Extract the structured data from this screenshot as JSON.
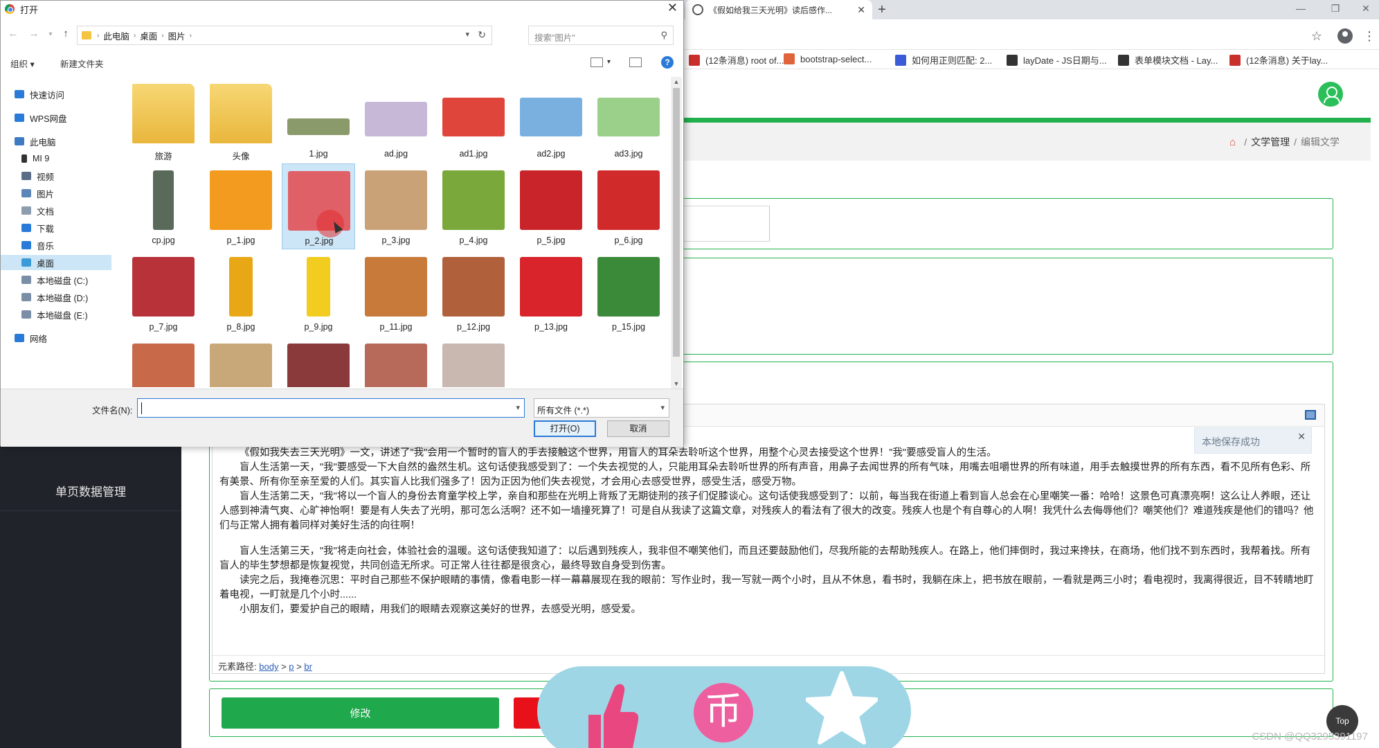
{
  "browser": {
    "tab_title": "《假如给我三天光明》读后感作...",
    "bookmarks": [
      {
        "label": "(12条消息) root of...",
        "color": "#c9302c"
      },
      {
        "label": "bootstrap-select...",
        "color": "#e0643b"
      },
      {
        "label": "如何用正则匹配: 2...",
        "color": "#3b5bd8"
      },
      {
        "label": "layDate - JS日期与...",
        "color": "#333333"
      },
      {
        "label": "表单模块文档 - Lay...",
        "color": "#333333"
      },
      {
        "label": "(12条消息) 关于lay...",
        "color": "#c9302c"
      }
    ]
  },
  "admin": {
    "breadcrumb": {
      "section": "文学管理",
      "current": "编辑文学"
    },
    "sidebar_item": "单页数据管理",
    "editor": {
      "saved_tip": "本地保存成功",
      "paragraphs": [
        "《假如我失去三天光明》一文，讲述了\"我\"会用一个暂时的盲人的手去接触这个世界，用盲人的耳朵去聆听这个世界，用整个心灵去接受这个世界！\"我\"要感受盲人的生活。",
        "盲人生活第一天，\"我\"要感受一下大自然的盎然生机。这句话使我感受到了：一个失去视觉的人，只能用耳朵去聆听世界的所有声音，用鼻子去闻世界的所有气味，用嘴去咀嚼世界的所有味道，用手去触摸世界的所有东西，看不见所有色彩、所有美景、所有你至亲至爱的人们。其实盲人比我们强多了！因为正因为他们失去视觉，才会用心去感受世界，感受生活，感受万物。",
        "盲人生活第二天，\"我\"将以一个盲人的身份去育童学校上学，亲自和那些在光明上背叛了无期徒刑的孩子们促膝谈心。这句话使我感受到了：以前，每当我在街道上看到盲人总会在心里嘲笑一番：哈哈！这景色可真漂亮啊！这么让人养眼，还让人感到神清气爽、心旷神怡啊！要是有人失去了光明，那可怎么活啊？还不如一墙撞死算了！可是自从我读了这篇文章，对残疾人的看法有了很大的改变。残疾人也是个有自尊心的人啊！我凭什么去侮辱他们？嘲笑他们？难道残疾是他们的错吗？他们与正常人拥有着同样对美好生活的向往啊！",
        "盲人生活第三天，\"我\"将走向社会，体验社会的温暖。这句话使我知道了：以后遇到残疾人，我非但不嘲笑他们，而且还要鼓励他们，尽我所能的去帮助残疾人。在路上，他们摔倒时，我过来搀扶，在商场，他们找不到东西时，我帮着找。所有盲人的毕生梦想都是恢复视觉，共同创造无所求。可正常人往往都是很贪心，最终导致自身受到伤害。",
        "读完之后，我掩卷沉思：平时自己那些不保护眼睛的事情，像看电影一样一幕幕展现在我的眼前：写作业时，我一写就一两个小时，且从不休息，看书时，我躺在床上，把书放在眼前，一看就是两三小时；看电视时，我离得很近，目不转睛地盯着电视，一盯就是几个小时......",
        "小朋友们，要爱护自己的眼睛，用我们的眼睛去观察这美好的世界，去感受光明，感受爱。"
      ],
      "path_label": "元素路径:",
      "path": [
        "body",
        "p",
        "br"
      ]
    },
    "modify_button": "修改",
    "top_button": "Top",
    "watermark": "CSDN @QQ3295391197"
  },
  "dialog": {
    "title": "打开",
    "address": [
      "此电脑",
      "桌面",
      "图片"
    ],
    "search_placeholder": "搜索\"图片\"",
    "organize": "组织 ▾",
    "new_folder": "新建文件夹",
    "help": "?",
    "nav": [
      {
        "label": "快速访问",
        "color": "#2a7ad8",
        "indent": 0
      },
      {
        "label": "WPS网盘",
        "color": "#2a7ad8",
        "indent": 0
      },
      {
        "label": "此电脑",
        "color": "#3d7bc4",
        "indent": 0
      },
      {
        "label": "MI 9",
        "color": "#333333",
        "indent": 1
      },
      {
        "label": "视频",
        "color": "#5a6c86",
        "indent": 1
      },
      {
        "label": "图片",
        "color": "#5a86b8",
        "indent": 1
      },
      {
        "label": "文档",
        "color": "#8d9cae",
        "indent": 1
      },
      {
        "label": "下载",
        "color": "#2a7ad8",
        "indent": 1
      },
      {
        "label": "音乐",
        "color": "#2a7ad8",
        "indent": 1
      },
      {
        "label": "桌面",
        "color": "#3d9ad8",
        "indent": 1,
        "selected": true
      },
      {
        "label": "本地磁盘 (C:)",
        "color": "#7a8ea6",
        "indent": 1
      },
      {
        "label": "本地磁盘 (D:)",
        "color": "#7a8ea6",
        "indent": 1
      },
      {
        "label": "本地磁盘 (E:)",
        "color": "#7a8ea6",
        "indent": 1
      },
      {
        "label": "网络",
        "color": "#2a7ad8",
        "indent": 0
      }
    ],
    "files": [
      {
        "name": "旅游",
        "kind": "folder",
        "color": "#e9b63c"
      },
      {
        "name": "头像",
        "kind": "folder",
        "color": "#e9b63c"
      },
      {
        "name": "1.jpg",
        "kind": "image",
        "color": "#8a9a6a"
      },
      {
        "name": "ad.jpg",
        "kind": "image",
        "color": "#c8b8d8"
      },
      {
        "name": "ad1.jpg",
        "kind": "image",
        "color": "#e0453b"
      },
      {
        "name": "ad2.jpg",
        "kind": "image",
        "color": "#7ab0e0"
      },
      {
        "name": "ad3.jpg",
        "kind": "image",
        "color": "#9ad08a"
      },
      {
        "name": "cp.jpg",
        "kind": "image",
        "color": "#5a6a5a"
      },
      {
        "name": "p_1.jpg",
        "kind": "image",
        "color": "#f29b1f"
      },
      {
        "name": "p_2.jpg",
        "kind": "image",
        "color": "#e06068",
        "selected": true
      },
      {
        "name": "p_3.jpg",
        "kind": "image",
        "color": "#c9a277"
      },
      {
        "name": "p_4.jpg",
        "kind": "image",
        "color": "#7aa83a"
      },
      {
        "name": "p_5.jpg",
        "kind": "image",
        "color": "#c8242a"
      },
      {
        "name": "p_6.jpg",
        "kind": "image",
        "color": "#d02a2a"
      },
      {
        "name": "p_7.jpg",
        "kind": "image",
        "color": "#b8323a"
      },
      {
        "name": "p_8.jpg",
        "kind": "image",
        "color": "#e8a816"
      },
      {
        "name": "p_9.jpg",
        "kind": "image",
        "color": "#f2cc1e"
      },
      {
        "name": "p_11.jpg",
        "kind": "image",
        "color": "#c87a3a"
      },
      {
        "name": "p_12.jpg",
        "kind": "image",
        "color": "#b0603a"
      },
      {
        "name": "p_13.jpg",
        "kind": "image",
        "color": "#d8242a"
      },
      {
        "name": "p_15.jpg",
        "kind": "image",
        "color": "#3a8a3a"
      },
      {
        "name": "",
        "kind": "image",
        "color": "#c86a4a"
      },
      {
        "name": "",
        "kind": "image",
        "color": "#c8a878"
      },
      {
        "name": "",
        "kind": "image",
        "color": "#8a3a3a"
      },
      {
        "name": "",
        "kind": "image",
        "color": "#b86a5a"
      },
      {
        "name": "",
        "kind": "image",
        "color": "#c8b8b0"
      }
    ],
    "filename_label": "文件名(N):",
    "filename_value": "",
    "file_type": "所有文件 (*.*)",
    "open_button": "打开(O)",
    "cancel_button": "取消"
  }
}
